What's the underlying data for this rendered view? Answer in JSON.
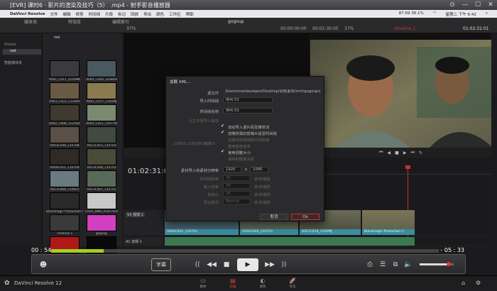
{
  "player": {
    "title": "[EVR] 课时6 · 影片的渲染及技巧（5） .mp4 - 射手影音播放器",
    "time_current": "00 : 54",
    "time_remaining": "- 05 : 33",
    "progress_fraction": 0.135,
    "subtitle_button": "字幕",
    "controls": [
      "⟨⟨",
      "◀◀",
      "■",
      "▶",
      "▶▶",
      "⟩⟩"
    ]
  },
  "menubar": {
    "app": "DaVinci Resolve",
    "items": [
      "文件",
      "编辑",
      "修剪",
      "时间线",
      "片段",
      "标记",
      "回放",
      "导出",
      "颜色",
      "工作区",
      "帮助"
    ],
    "status_text": "87.69 36.1%",
    "clock": "星期二 下午 6:42"
  },
  "resolve_top": {
    "tabs": [
      "媒体池",
      "特效库",
      "编辑索引"
    ],
    "project_title": "gogoup",
    "src_zoom": "37%",
    "src_timecode": "00:00:00:00",
    "tl_timecode_left": "00:02:30:05",
    "tl_zoom": "37%",
    "tl_timecode_right": "01:02:31:01",
    "tl_name": "timeline 1"
  },
  "media_pool": {
    "bins": [
      "Master",
      "red"
    ],
    "smart_bins": "智能媒体夹",
    "current_bin": "red",
    "clips": [
      {
        "name": "A001_C011_1105MK",
        "color": "#3a3a40"
      },
      {
        "name": "A004_C049_1108D9",
        "color": "#4a5860"
      },
      {
        "name": "A001_C022_11100A",
        "color": "#6a5a44"
      },
      {
        "name": "A001_C017_1105MJ",
        "color": "#8a7a50"
      },
      {
        "name": "B002_C008_1120Q4",
        "color": "#3e3a30"
      },
      {
        "name": "A002_C021_11071N",
        "color": "#7a8a70"
      },
      {
        "name": "A003C048_110708",
        "color": "#5a5048"
      },
      {
        "name": "A011C015_110703",
        "color": "#404a40"
      },
      {
        "name": "A009C021_110706",
        "color": "#302a26"
      },
      {
        "name": "A013C049_110703",
        "color": "#4a4a38"
      },
      {
        "name": "A013C008_110901",
        "color": "#6a7a80"
      },
      {
        "name": "A013C007_110701",
        "color": "#5a6a58"
      },
      {
        "name": "Blackmagic Production Camera",
        "color": "#2a2a2a"
      },
      {
        "name": "Chart_BMD_Pixel.mov",
        "color": "#c8c8c8"
      },
      {
        "name": "Timeline 1",
        "color": "#3a3a3a"
      },
      {
        "name": "gogoup",
        "color": "#d040c0"
      },
      {
        "name": "英国",
        "color": "#b01818"
      },
      {
        "name": "gogoup (Resolve)",
        "color": "#0a0a0a"
      }
    ]
  },
  "timeline": {
    "timecode": "01:02:31:01",
    "tracks": [
      "V1 视频 1",
      "A1 音频 1"
    ],
    "clip_labels": [
      "A003C021_110710",
      "A003C044_110703",
      "A017C019_1105MJ",
      "Blackmagic Production C"
    ]
  },
  "dialog": {
    "title": "加载 XML...",
    "fields": [
      {
        "label": "源文件",
        "value": "/Users/macbookpro/Desktop/调色素材/xml/gogoup小丝路路.xml"
      },
      {
        "label": "导入时间线",
        "value": "序列 01"
      },
      {
        "label": "时间线名称",
        "value": "序列 01"
      }
    ],
    "note": "从文件夹导入素材",
    "checks": [
      {
        "label": "自动导入源片段至媒体池",
        "checked": true,
        "dim": false
      },
      {
        "label": "忽略所需的剪辑片段至时间线",
        "checked": true,
        "dim": false
      },
      {
        "label": "忽略项目剪辑源中的剪辑",
        "checked": false,
        "dim": true
      },
      {
        "label": "使用颜色信息",
        "checked": false,
        "dim": true
      },
      {
        "label": "使用调整大小",
        "checked": true,
        "dim": false
      },
      {
        "label": "保持和隔离关联",
        "checked": false,
        "dim": true
      }
    ],
    "left_hint": "1080/1.2/自动的/编辑/5",
    "res_label": "素材导入的素材分辨率",
    "res_w": "1920",
    "res_x": "x",
    "res_h": "1080",
    "dim_rows": [
      {
        "label": "时间线帧率",
        "value": "25",
        "tag": "帧/秒播放"
      },
      {
        "label": "输入帧率",
        "value": "25",
        "tag": "帧/秒播放"
      },
      {
        "label": "宽高比",
        "value": "25",
        "tag": "帧/秒播放"
      },
      {
        "label": "混合模式",
        "value": "Normal",
        "tag": "帧/秒播放"
      }
    ],
    "cancel": "取消",
    "ok": "Ok"
  },
  "bottom": {
    "app_name": "DaVinci Resolve 12",
    "pages": [
      "媒体",
      "剪辑",
      "调色",
      "导出"
    ],
    "active_page": "剪辑"
  },
  "colors": {
    "accent_red": "#c8302a",
    "progress_green": "#a4d020",
    "clip_teal": "#3a8ca0",
    "audio_green": "#3c7850"
  }
}
